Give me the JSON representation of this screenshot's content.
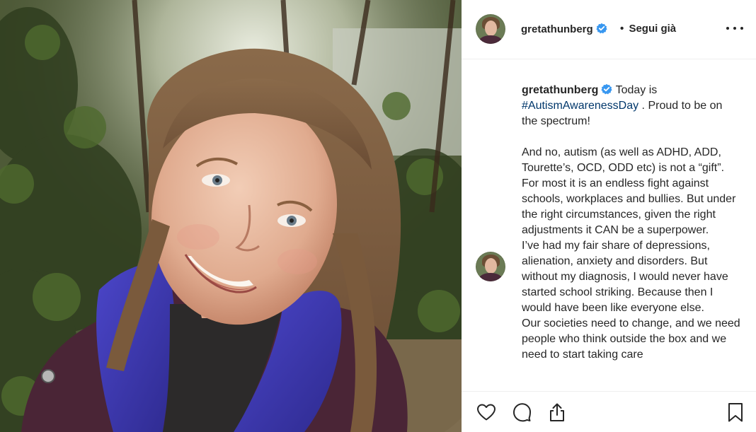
{
  "post": {
    "username": "gretathunberg",
    "follow_separator": "•",
    "follow_status": "Segui già",
    "photo_icon": "portrait-photo",
    "verified_icon": "verified-badge-icon",
    "more_icon": "more-options-icon"
  },
  "caption": {
    "username": "gretathunberg",
    "part1": " Today is ",
    "hashtag": "#AutismAwarenessDay",
    "part2": " . Proud to be on the spectrum!\n\nAnd no, autism (as well as ADHD, ADD, Tourette’s, OCD, ODD etc) is not a “gift”. For most it is an endless fight against schools, workplaces and bullies. But under the right circumstances, given the right adjustments it CAN be a superpower.\nI’ve had my fair share of depressions, alienation, anxiety and disorders. But without my diagnosis, I would never have started school striking. Because then I would have been like everyone else.\nOur societies need to change, and we need people who think outside the box and we need to start taking care"
  },
  "actions": {
    "like_icon": "heart-icon",
    "comment_icon": "comment-icon",
    "share_icon": "share-icon",
    "save_icon": "bookmark-icon"
  },
  "colors": {
    "text": "#262626",
    "hashtag": "#00376b",
    "verified": "#3897f0",
    "divider": "#efefef"
  }
}
